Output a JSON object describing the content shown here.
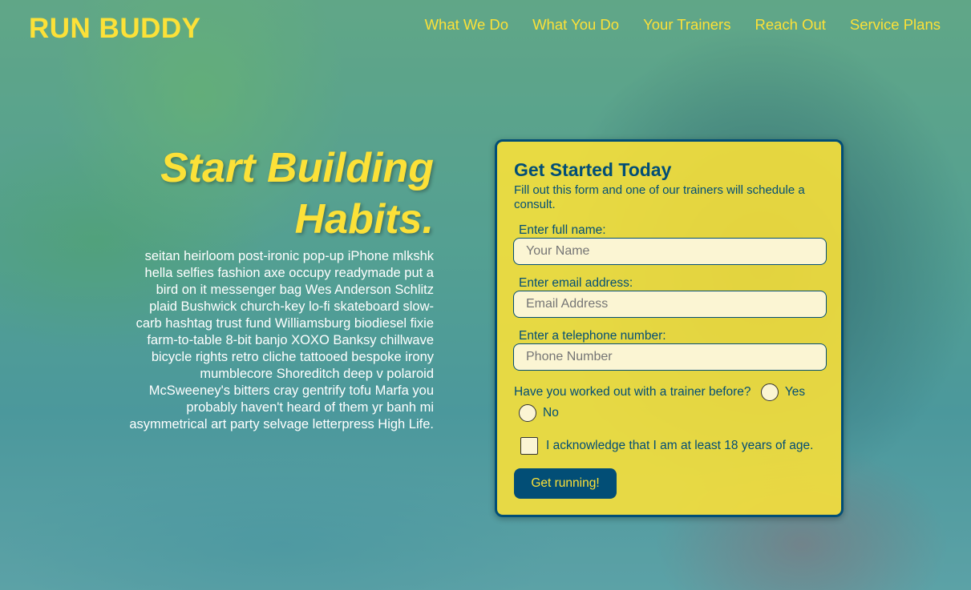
{
  "header": {
    "logo": "RUN BUDDY",
    "nav": [
      "What We Do",
      "What You Do",
      "Your Trainers",
      "Reach Out",
      "Service Plans"
    ]
  },
  "hero": {
    "title": "Start Building Habits.",
    "body": "seitan heirloom post-ironic pop-up iPhone mlkshk hella selfies fashion axe occupy readymade put a bird on it messenger bag Wes Anderson Schlitz plaid Bushwick church-key lo-fi skateboard slow-carb hashtag trust fund Williamsburg biodiesel fixie farm-to-table 8-bit banjo XOXO Banksy chillwave bicycle rights retro cliche tattooed bespoke irony mumblecore Shoreditch deep v polaroid McSweeney's bitters cray gentrify tofu Marfa you probably haven't heard of them yr banh mi asymmetrical art party selvage letterpress High Life."
  },
  "form": {
    "title": "Get Started Today",
    "description": "Fill out this form and one of our trainers will schedule a consult.",
    "name_label": "Enter full name:",
    "name_placeholder": "Your Name",
    "email_label": "Enter email address:",
    "email_placeholder": "Email Address",
    "phone_label": "Enter a telephone number:",
    "phone_placeholder": "Phone Number",
    "trainer_question": "Have you worked out with a trainer before?",
    "yes_label": "Yes",
    "no_label": "No",
    "age_ack": "I acknowledge that I am at least 18 years of age.",
    "submit_label": "Get running!"
  },
  "colors": {
    "accent": "#fce138",
    "primary": "#024e76"
  }
}
